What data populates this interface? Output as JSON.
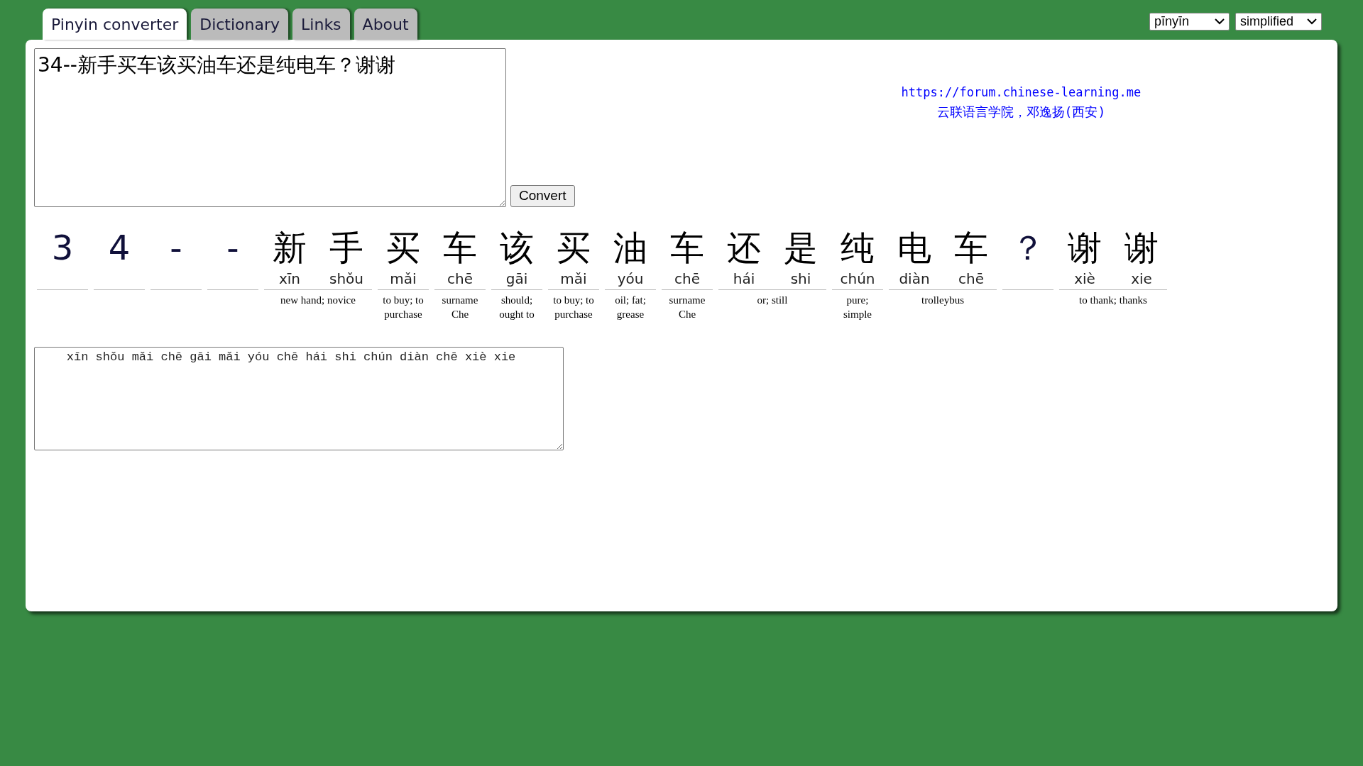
{
  "tabs": [
    {
      "label": "Pinyin converter",
      "selected": true
    },
    {
      "label": "Dictionary",
      "selected": false
    },
    {
      "label": "Links",
      "selected": false
    },
    {
      "label": "About",
      "selected": false
    }
  ],
  "selects": [
    {
      "value": "pīnyīn"
    },
    {
      "value": "simplified"
    }
  ],
  "input": {
    "value": "34--新手买车该买油车还是纯电车？谢谢"
  },
  "convert_button": "Convert",
  "credit": {
    "link": "https://forum.chinese-learning.me",
    "text": "云联语言学院，邓逸扬(西安)"
  },
  "words": [
    {
      "kind": "symbol",
      "chars": [
        {
          "char": "3"
        }
      ]
    },
    {
      "kind": "symbol",
      "chars": [
        {
          "char": "4"
        }
      ]
    },
    {
      "kind": "symbol",
      "chars": [
        {
          "char": "-"
        }
      ]
    },
    {
      "kind": "symbol",
      "chars": [
        {
          "char": "-"
        }
      ]
    },
    {
      "kind": "hanzi",
      "chars": [
        {
          "char": "新",
          "pinyin": "xīn"
        },
        {
          "char": "手",
          "pinyin": "shǒu"
        }
      ],
      "definition": "new hand; novice"
    },
    {
      "kind": "hanzi",
      "chars": [
        {
          "char": "买",
          "pinyin": "mǎi"
        }
      ],
      "definition": "to buy; to purchase"
    },
    {
      "kind": "hanzi",
      "chars": [
        {
          "char": "车",
          "pinyin": "chē"
        }
      ],
      "definition": "surname Che"
    },
    {
      "kind": "hanzi",
      "chars": [
        {
          "char": "该",
          "pinyin": "gāi"
        }
      ],
      "definition": "should; ought to"
    },
    {
      "kind": "hanzi",
      "chars": [
        {
          "char": "买",
          "pinyin": "mǎi"
        }
      ],
      "definition": "to buy; to purchase"
    },
    {
      "kind": "hanzi",
      "chars": [
        {
          "char": "油",
          "pinyin": "yóu"
        }
      ],
      "definition": "oil; fat; grease"
    },
    {
      "kind": "hanzi",
      "chars": [
        {
          "char": "车",
          "pinyin": "chē"
        }
      ],
      "definition": "surname Che"
    },
    {
      "kind": "hanzi",
      "chars": [
        {
          "char": "还",
          "pinyin": "hái"
        },
        {
          "char": "是",
          "pinyin": "shi"
        }
      ],
      "definition": "or; still"
    },
    {
      "kind": "hanzi",
      "chars": [
        {
          "char": "纯",
          "pinyin": "chún"
        }
      ],
      "definition": "pure; simple"
    },
    {
      "kind": "hanzi",
      "chars": [
        {
          "char": "电",
          "pinyin": "diàn"
        },
        {
          "char": "车",
          "pinyin": "chē"
        }
      ],
      "definition": "trolleybus"
    },
    {
      "kind": "symbol",
      "chars": [
        {
          "char": "？"
        }
      ]
    },
    {
      "kind": "hanzi",
      "chars": [
        {
          "char": "谢",
          "pinyin": "xiè"
        },
        {
          "char": "谢",
          "pinyin": "xie"
        }
      ],
      "definition": "to thank; thanks"
    }
  ],
  "output": {
    "value": "    xīn shǒu mǎi chē gāi mǎi yóu chē hái shi chún diàn chē xiè xie"
  }
}
